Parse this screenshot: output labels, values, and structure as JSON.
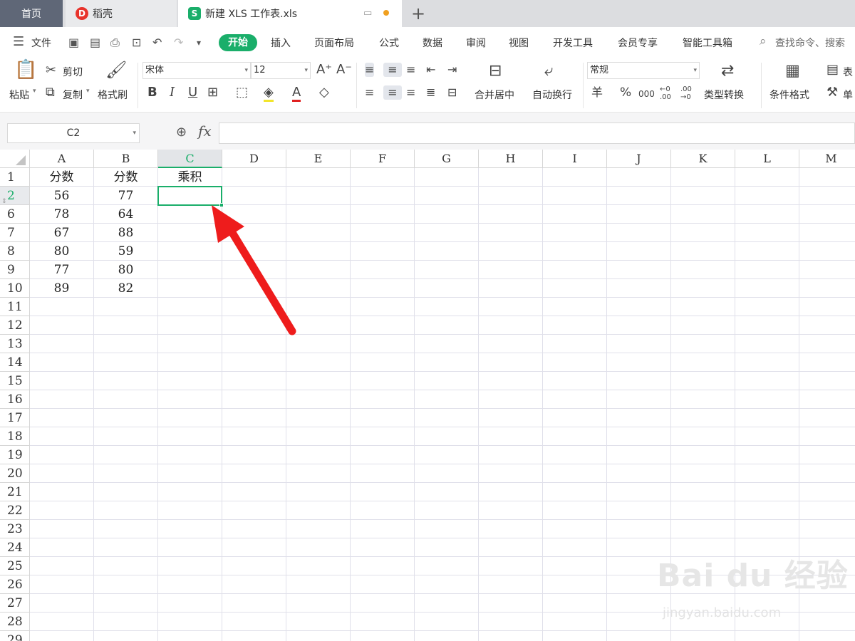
{
  "tabs": {
    "home": "首页",
    "daoke": "稻壳",
    "doc": "新建 XLS 工作表.xls",
    "doc_logo": "S",
    "add": "+"
  },
  "menu": {
    "file": "文件",
    "items": [
      "开始",
      "插入",
      "页面布局",
      "公式",
      "数据",
      "审阅",
      "视图",
      "开发工具",
      "会员专享",
      "智能工具箱"
    ],
    "search": "查找命令、搜索"
  },
  "ribbon": {
    "paste": "粘贴",
    "cut": "剪切",
    "copy": "复制",
    "format_painter": "格式刷",
    "font_name": "宋体",
    "font_size": "12",
    "bold": "B",
    "italic": "I",
    "underline": "U",
    "merge_center": "合并居中",
    "wrap_text": "自动换行",
    "number_format": "常规",
    "currency": "羊",
    "percent": "%",
    "thousands": "000",
    "inc_decimal": "←0 .00",
    "dec_decimal": ".00 →0",
    "type_convert": "类型转换",
    "conditional_format": "条件格式",
    "table_style": "表",
    "cell": "单"
  },
  "formula_bar": {
    "name_box": "C2",
    "fx": "fx",
    "value": ""
  },
  "sheet": {
    "columns": [
      "A",
      "B",
      "C",
      "D",
      "E",
      "F",
      "G",
      "H",
      "I",
      "J",
      "K",
      "L",
      "M"
    ],
    "active_column": "C",
    "rows": [
      {
        "num": "1",
        "cells": [
          "分数",
          "分数",
          "乘积"
        ]
      },
      {
        "num": "2",
        "cells": [
          "56",
          "77",
          ""
        ]
      },
      {
        "num": "6",
        "cells": [
          "78",
          "64",
          ""
        ]
      },
      {
        "num": "7",
        "cells": [
          "67",
          "88",
          ""
        ]
      },
      {
        "num": "8",
        "cells": [
          "80",
          "59",
          ""
        ]
      },
      {
        "num": "9",
        "cells": [
          "77",
          "80",
          ""
        ]
      },
      {
        "num": "10",
        "cells": [
          "89",
          "82",
          ""
        ]
      },
      {
        "num": "11",
        "cells": [
          "",
          "",
          ""
        ]
      },
      {
        "num": "12",
        "cells": [
          "",
          "",
          ""
        ]
      },
      {
        "num": "13",
        "cells": [
          "",
          "",
          ""
        ]
      },
      {
        "num": "14",
        "cells": [
          "",
          "",
          ""
        ]
      },
      {
        "num": "15",
        "cells": [
          "",
          "",
          ""
        ]
      },
      {
        "num": "16",
        "cells": [
          "",
          "",
          ""
        ]
      },
      {
        "num": "17",
        "cells": [
          "",
          "",
          ""
        ]
      },
      {
        "num": "18",
        "cells": [
          "",
          "",
          ""
        ]
      },
      {
        "num": "19",
        "cells": [
          "",
          "",
          ""
        ]
      },
      {
        "num": "20",
        "cells": [
          "",
          "",
          ""
        ]
      },
      {
        "num": "21",
        "cells": [
          "",
          "",
          ""
        ]
      },
      {
        "num": "22",
        "cells": [
          "",
          "",
          ""
        ]
      },
      {
        "num": "23",
        "cells": [
          "",
          "",
          ""
        ]
      },
      {
        "num": "24",
        "cells": [
          "",
          "",
          ""
        ]
      },
      {
        "num": "25",
        "cells": [
          "",
          "",
          ""
        ]
      },
      {
        "num": "26",
        "cells": [
          "",
          "",
          ""
        ]
      },
      {
        "num": "27",
        "cells": [
          "",
          "",
          ""
        ]
      },
      {
        "num": "28",
        "cells": [
          "",
          "",
          ""
        ]
      },
      {
        "num": "29",
        "cells": [
          "",
          "",
          ""
        ]
      }
    ],
    "active_row": "2"
  },
  "watermark": {
    "brand": "Bai du 经验",
    "url": "jingyan.baidu.com"
  },
  "colors": {
    "accent": "#1aae6a",
    "arrow": "#ee1c1c"
  }
}
